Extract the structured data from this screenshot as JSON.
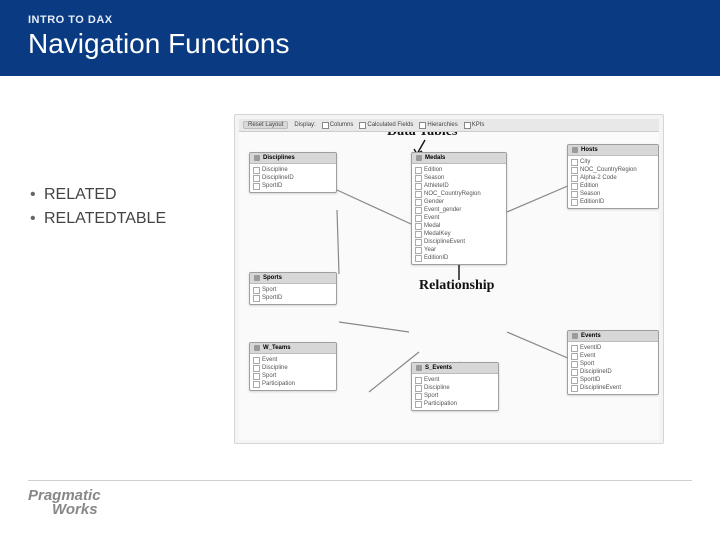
{
  "header": {
    "kicker": "INTRO TO DAX",
    "title": "Navigation Functions"
  },
  "bullets": [
    "RELATED",
    "RELATEDTABLE"
  ],
  "toolbar": {
    "reset": "Reset Layout",
    "display": "Display:",
    "cb1": "Columns",
    "cb2": "Calculated Fields",
    "cb3": "Hierarchies",
    "cb4": "KPIs"
  },
  "annotations": {
    "data_tables": "Data Tables",
    "relationship": "Relationship"
  },
  "tables": {
    "disciplines": {
      "name": "Disciplines",
      "fields": [
        "Discipline",
        "DisciplineID",
        "SportID"
      ]
    },
    "medals": {
      "name": "Medals",
      "fields": [
        "Edition",
        "Season",
        "AthleteID",
        "NOC_CountryRegion",
        "Gender",
        "Event_gender",
        "Event",
        "Medal",
        "MedalKey",
        "DisciplineEvent",
        "Year",
        "EditionID"
      ]
    },
    "hosts": {
      "name": "Hosts",
      "fields": [
        "City",
        "NOC_CountryRegion",
        "Alpha-2 Code",
        "Edition",
        "Season",
        "EditionID"
      ]
    },
    "sports": {
      "name": "Sports",
      "fields": [
        "Sport",
        "SportID"
      ]
    },
    "wteams": {
      "name": "W_Teams",
      "fields": [
        "Event",
        "Discipline",
        "Sport",
        "Participation"
      ]
    },
    "sevents": {
      "name": "S_Events",
      "fields": [
        "Event",
        "Discipline",
        "Sport",
        "Participation"
      ]
    },
    "events": {
      "name": "Events",
      "fields": [
        "EventID",
        "Event",
        "Sport",
        "DisciplineID",
        "SportID",
        "DisciplineEvent"
      ]
    }
  },
  "logo": {
    "line1": "Pragmatic",
    "line2": "Works"
  }
}
